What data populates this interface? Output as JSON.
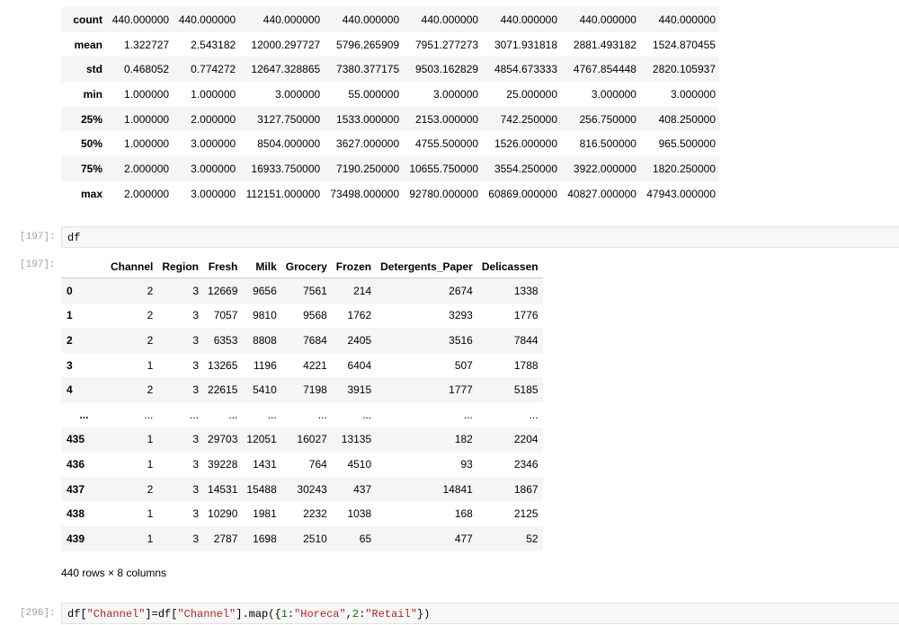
{
  "describe": {
    "rows": [
      {
        "label": "count",
        "values": [
          "440.000000",
          "440.000000",
          "440.000000",
          "440.000000",
          "440.000000",
          "440.000000",
          "440.000000",
          "440.000000"
        ]
      },
      {
        "label": "mean",
        "values": [
          "1.322727",
          "2.543182",
          "12000.297727",
          "5796.265909",
          "7951.277273",
          "3071.931818",
          "2881.493182",
          "1524.870455"
        ]
      },
      {
        "label": "std",
        "values": [
          "0.468052",
          "0.774272",
          "12647.328865",
          "7380.377175",
          "9503.162829",
          "4854.673333",
          "4767.854448",
          "2820.105937"
        ]
      },
      {
        "label": "min",
        "values": [
          "1.000000",
          "1.000000",
          "3.000000",
          "55.000000",
          "3.000000",
          "25.000000",
          "3.000000",
          "3.000000"
        ]
      },
      {
        "label": "25%",
        "values": [
          "1.000000",
          "2.000000",
          "3127.750000",
          "1533.000000",
          "2153.000000",
          "742.250000",
          "256.750000",
          "408.250000"
        ]
      },
      {
        "label": "50%",
        "values": [
          "1.000000",
          "3.000000",
          "8504.000000",
          "3627.000000",
          "4755.500000",
          "1526.000000",
          "816.500000",
          "965.500000"
        ]
      },
      {
        "label": "75%",
        "values": [
          "2.000000",
          "3.000000",
          "16933.750000",
          "7190.250000",
          "10655.750000",
          "3554.250000",
          "3922.000000",
          "1820.250000"
        ]
      },
      {
        "label": "max",
        "values": [
          "2.000000",
          "3.000000",
          "112151.000000",
          "73498.000000",
          "92780.000000",
          "60869.000000",
          "40827.000000",
          "47943.000000"
        ]
      }
    ]
  },
  "cells": [
    {
      "prompt": "[197]:",
      "code": "df"
    },
    {
      "prompt": "[296]:",
      "code_parts": [
        "df[",
        "\"Channel\"",
        "]=df[",
        "\"Channel\"",
        "].map({",
        "1",
        ":",
        "\"Horeca\"",
        ",",
        "2",
        ":",
        "\"Retail\"",
        "})"
      ]
    }
  ],
  "output_prompt": "[197]:",
  "dataframe": {
    "columns": [
      "Channel",
      "Region",
      "Fresh",
      "Milk",
      "Grocery",
      "Frozen",
      "Detergents_Paper",
      "Delicassen"
    ],
    "rows": [
      {
        "idx": "0",
        "values": [
          "2",
          "3",
          "12669",
          "9656",
          "7561",
          "214",
          "2674",
          "1338"
        ]
      },
      {
        "idx": "1",
        "values": [
          "2",
          "3",
          "7057",
          "9810",
          "9568",
          "1762",
          "3293",
          "1776"
        ]
      },
      {
        "idx": "2",
        "values": [
          "2",
          "3",
          "6353",
          "8808",
          "7684",
          "2405",
          "3516",
          "7844"
        ]
      },
      {
        "idx": "3",
        "values": [
          "1",
          "3",
          "13265",
          "1196",
          "4221",
          "6404",
          "507",
          "1788"
        ]
      },
      {
        "idx": "4",
        "values": [
          "2",
          "3",
          "22615",
          "5410",
          "7198",
          "3915",
          "1777",
          "5185"
        ]
      },
      {
        "idx": "...",
        "values": [
          "...",
          "...",
          "...",
          "...",
          "...",
          "...",
          "...",
          "..."
        ]
      },
      {
        "idx": "435",
        "values": [
          "1",
          "3",
          "29703",
          "12051",
          "16027",
          "13135",
          "182",
          "2204"
        ]
      },
      {
        "idx": "436",
        "values": [
          "1",
          "3",
          "39228",
          "1431",
          "764",
          "4510",
          "93",
          "2346"
        ]
      },
      {
        "idx": "437",
        "values": [
          "2",
          "3",
          "14531",
          "15488",
          "30243",
          "437",
          "14841",
          "1867"
        ]
      },
      {
        "idx": "438",
        "values": [
          "1",
          "3",
          "10290",
          "1981",
          "2232",
          "1038",
          "168",
          "2125"
        ]
      },
      {
        "idx": "439",
        "values": [
          "1",
          "3",
          "2787",
          "1698",
          "2510",
          "65",
          "477",
          "52"
        ]
      }
    ],
    "shape": "440 rows × 8 columns"
  }
}
